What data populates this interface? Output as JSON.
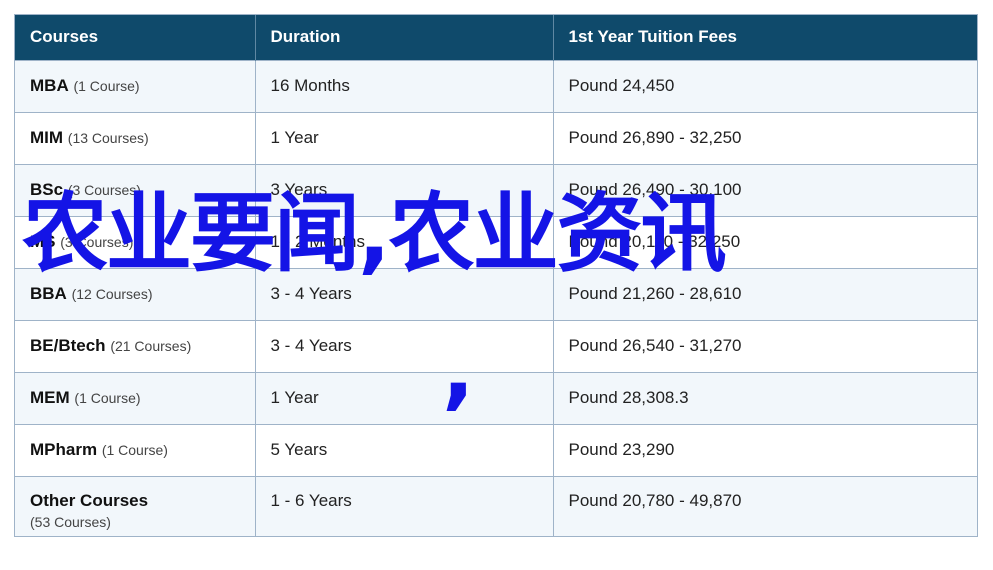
{
  "table": {
    "headers": [
      "Courses",
      "Duration",
      "1st Year Tuition Fees"
    ],
    "rows": [
      {
        "name": "MBA",
        "count": "(1 Course)",
        "duration": "16 Months",
        "fees": "Pound 24,450"
      },
      {
        "name": "MIM",
        "count": "(13 Courses)",
        "duration": "1 Year",
        "fees": "Pound 26,890 - 32,250"
      },
      {
        "name": "BSc",
        "count": "(3 Courses)",
        "duration": "3 Years",
        "fees": "Pound 26,490 - 30,100"
      },
      {
        "name": "MS",
        "count": "(3 Courses)",
        "duration": "1 - 2 Months",
        "fees": "Pound 20,110 - 32,250"
      },
      {
        "name": "BBA",
        "count": "(12 Courses)",
        "duration": "3 - 4 Years",
        "fees": "Pound 21,260 - 28,610"
      },
      {
        "name": "BE/Btech",
        "count": "(21 Courses)",
        "duration": "3 - 4 Years",
        "fees": "Pound 26,540 - 31,270"
      },
      {
        "name": "MEM",
        "count": "(1 Course)",
        "duration": "1 Year",
        "fees": "Pound 28,308.3"
      },
      {
        "name": "MPharm",
        "count": "(1 Course)",
        "duration": "5 Years",
        "fees": "Pound 23,290"
      },
      {
        "name": "Other Courses",
        "count": "(53 Courses)",
        "duration": "1 - 6 Years",
        "fees": "Pound 20,780 - 49,870"
      }
    ]
  },
  "overlay": {
    "text": "农业要闻,农业资讯",
    "comma": ",",
    "color": "#1414e6"
  },
  "colors": {
    "header_bg": "#0f4a6b",
    "stripe_bg": "#f2f7fb",
    "border": "#9fb3c8"
  }
}
